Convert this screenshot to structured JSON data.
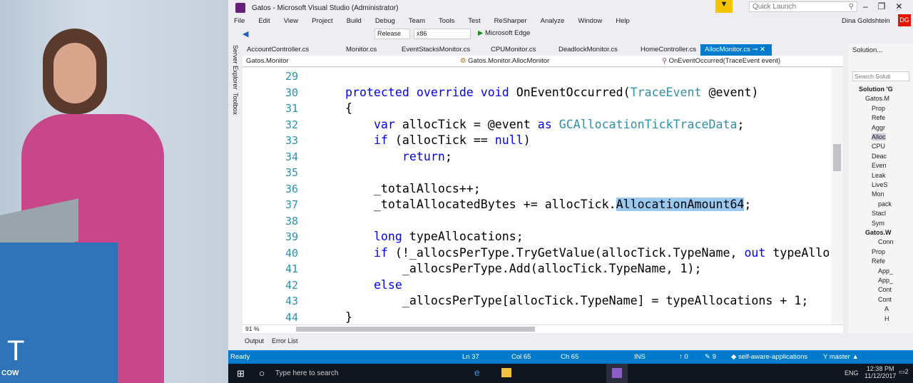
{
  "window": {
    "title": "Gatos - Microsoft Visual Studio (Administrator)",
    "quick_launch": "Quick Launch",
    "user": "Dina Goldshtein",
    "user_initials": "DG"
  },
  "menu": [
    "File",
    "Edit",
    "View",
    "Project",
    "Build",
    "Debug",
    "Team",
    "Tools",
    "Test",
    "ReSharper",
    "Analyze",
    "Window",
    "Help"
  ],
  "toolbar": {
    "config": "Release",
    "platform": "x86",
    "run_target": "Microsoft Edge"
  },
  "side_tabs": [
    "Server Explorer",
    "Toolbox"
  ],
  "tabs": [
    "AccountController.cs",
    "Monitor.cs",
    "EventStacksMonitor.cs",
    "CPUMonitor.cs",
    "DeadlockMonitor.cs",
    "HomeController.cs",
    "AllocMonitor.cs"
  ],
  "active_tab": "AllocMonitor.cs",
  "nav": {
    "project": "Gatos.Monitor",
    "type": "Gatos.Monitor.AllocMonitor",
    "member": "OnEventOccurred(TraceEvent event)"
  },
  "code": [
    {
      "n": "29",
      "t": []
    },
    {
      "n": "30",
      "t": [
        [
          "    ",
          ""
        ],
        [
          "protected override void ",
          "kw"
        ],
        [
          "OnEventOccurred(",
          ""
        ],
        [
          "TraceEvent",
          "ty"
        ],
        [
          " @event)",
          ""
        ]
      ]
    },
    {
      "n": "31",
      "t": [
        [
          "    {",
          ""
        ]
      ]
    },
    {
      "n": "32",
      "t": [
        [
          "        ",
          ""
        ],
        [
          "var",
          "kw"
        ],
        [
          " allocTick = @event ",
          ""
        ],
        [
          "as",
          "kw"
        ],
        [
          " ",
          ""
        ],
        [
          "GCAllocationTickTraceData",
          "ty"
        ],
        [
          ";",
          ""
        ]
      ]
    },
    {
      "n": "33",
      "t": [
        [
          "        ",
          ""
        ],
        [
          "if",
          "kw"
        ],
        [
          " (allocTick == ",
          ""
        ],
        [
          "null",
          "kw"
        ],
        [
          ")",
          ""
        ]
      ]
    },
    {
      "n": "34",
      "t": [
        [
          "            ",
          ""
        ],
        [
          "return",
          "kw"
        ],
        [
          ";",
          ""
        ]
      ]
    },
    {
      "n": "35",
      "t": []
    },
    {
      "n": "36",
      "t": [
        [
          "        _totalAllocs++;",
          ""
        ]
      ]
    },
    {
      "n": "37",
      "t": [
        [
          "        _totalAllocatedBytes += allocTick.",
          ""
        ],
        [
          "AllocationAmount64",
          "sel"
        ],
        [
          ";",
          ""
        ]
      ]
    },
    {
      "n": "38",
      "t": []
    },
    {
      "n": "39",
      "t": [
        [
          "        ",
          ""
        ],
        [
          "long",
          "kw"
        ],
        [
          " typeAllocations;",
          ""
        ]
      ]
    },
    {
      "n": "40",
      "t": [
        [
          "        ",
          ""
        ],
        [
          "if",
          "kw"
        ],
        [
          " (!_allocsPerType.TryGetValue(allocTick.TypeName, ",
          ""
        ],
        [
          "out",
          "kw"
        ],
        [
          " typeAllo",
          ""
        ]
      ]
    },
    {
      "n": "41",
      "t": [
        [
          "            _allocsPerType.Add(allocTick.TypeName, 1);",
          ""
        ]
      ]
    },
    {
      "n": "42",
      "t": [
        [
          "        ",
          ""
        ],
        [
          "else",
          "kw"
        ]
      ]
    },
    {
      "n": "43",
      "t": [
        [
          "            _allocsPerType[allocTick.TypeName] = typeAllocations + 1;",
          ""
        ]
      ]
    },
    {
      "n": "44",
      "t": [
        [
          "    }",
          ""
        ]
      ]
    }
  ],
  "zoom": "91 %",
  "bottom_tabs": [
    "Output",
    "Error List"
  ],
  "solution": {
    "title": "Solution...",
    "search": "Search Soluti",
    "items": [
      "Solution 'G",
      "Gatos.M",
      "Prop",
      "Refe",
      "Aggr",
      "Alloc",
      "CPU",
      "Deac",
      "Even",
      "Leak",
      "LiveS",
      "Mon",
      "pack",
      "Stacl",
      "Sym",
      "Gatos.W",
      "Conn",
      "Prop",
      "Refe",
      "App_",
      "App_",
      "Cont",
      "Cont",
      "A",
      "H"
    ]
  },
  "status": {
    "state": "Ready",
    "ln": "Ln 37",
    "col": "Col 65",
    "ch": "Ch 65",
    "mode": "INS",
    "push": "0",
    "edits": "9",
    "repo": "self-aware-applications",
    "branch": "master"
  },
  "taskbar": {
    "search": "Type here to search",
    "time": "12:38 PM",
    "date": "11/12/2017",
    "lang": "ENG",
    "notifications": "2"
  },
  "logo": {
    "text1": "T",
    "text2": "COW"
  },
  "colors": {
    "accent": "#007acc",
    "keyword": "#0000ff",
    "type": "#2b91af",
    "selection": "#99c9ef"
  }
}
